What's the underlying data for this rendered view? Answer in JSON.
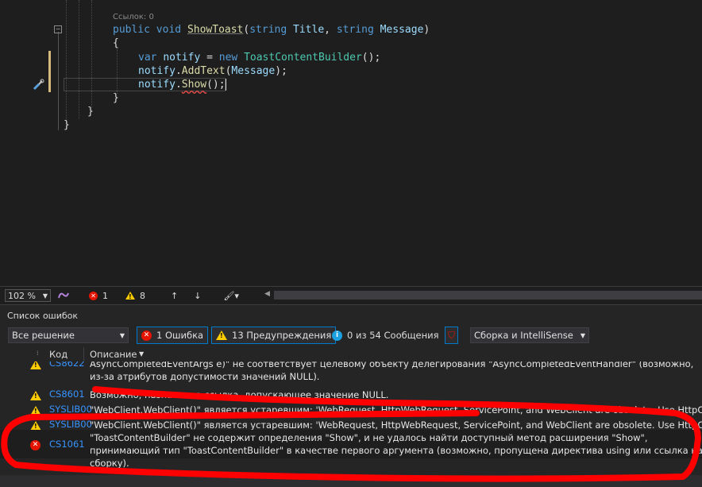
{
  "editor": {
    "codelens": "Ссылок: 0",
    "lines": {
      "sig_kw1": "public",
      "sig_kw2": "void",
      "sig_fn": "ShowToast",
      "sig_p1type": "string",
      "sig_p1": "Title",
      "sig_p2type": "string",
      "sig_p2": "Message",
      "open1": "{",
      "l1_var": "var",
      "l1_id": "notify",
      "l1_new": "new",
      "l1_type": "ToastContentBuilder",
      "l2_id": "notify",
      "l2_fn": "AddText",
      "l2_arg": "Message",
      "l3_id": "notify",
      "l3_fn": "Show",
      "close1": "}",
      "close2": "}",
      "close3": "}"
    }
  },
  "statusbar": {
    "zoom": "102 %",
    "errors": "1",
    "warnings": "8"
  },
  "error_list": {
    "title": "Список ошибок",
    "scope": "Все решение",
    "errors_filter": "1 Ошибка",
    "warnings_filter": "13 Предупреждения",
    "messages_filter": "0 из 54 Сообщения",
    "build_mode": "Сборка и IntelliSense",
    "col_code": "Код",
    "col_desc": "Описание",
    "rows": [
      {
        "code": "CS8622",
        "desc": "AsyncCompletedEventArgs e)\" не соответствует целевому объекту делегирования \"AsyncCompletedEventHandler\" (возможно, из-за атрибутов допустимости значений NULL).",
        "severity": "warning"
      },
      {
        "code": "CS8601",
        "desc": "Возможно, назначение-ссылка, допускающее значение NULL.",
        "severity": "warning"
      },
      {
        "code": "SYSLIB00",
        "desc": "\"WebClient.WebClient()\" является устаревшим: 'WebRequest, HttpWebRequest, ServicePoint, and WebClient are obsolete. Use HttpClient instead",
        "severity": "warning"
      },
      {
        "code": "SYSLIB00",
        "desc": "\"WebClient.WebClient()\" является устаревшим: 'WebRequest, HttpWebRequest, ServicePoint, and WebClient are obsolete. Use HttpClient instead",
        "severity": "warning"
      },
      {
        "code": "CS1061",
        "desc": "\"ToastContentBuilder\" не содержит определения \"Show\", и не удалось найти доступный метод расширения \"Show\", принимающий тип \"ToastContentBuilder\" в качестве первого аргумента (возможно, пропущена директива using или ссылка на сборку).",
        "severity": "error"
      }
    ]
  },
  "colors": {
    "annotation": "#ff0000",
    "link": "#3794ff",
    "error": "#e51400",
    "warning": "#ffcc00"
  }
}
